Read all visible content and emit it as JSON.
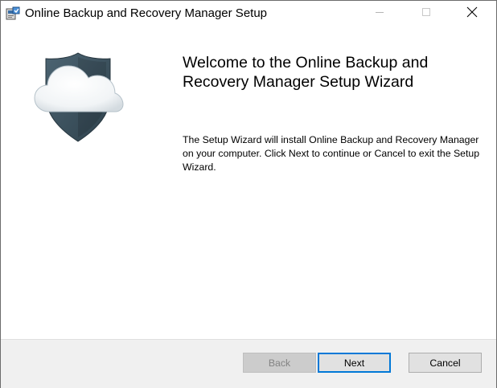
{
  "window": {
    "title": "Online Backup and Recovery Manager Setup"
  },
  "content": {
    "heading": "Welcome to the Online Backup and Recovery Manager Setup Wizard",
    "description": "The Setup Wizard will install Online Backup and Recovery Manager on your computer. Click Next to continue or Cancel to exit the Setup Wizard."
  },
  "buttons": {
    "back": "Back",
    "next": "Next",
    "cancel": "Cancel"
  },
  "icons": {
    "app": "installer-icon",
    "logo": "cloud-shield-logo",
    "minimize": "minimize-icon",
    "maximize": "maximize-icon",
    "close": "close-icon"
  },
  "colors": {
    "accent": "#0078d7",
    "shield": "#3e5360",
    "footer_bg": "#f0f0f0"
  },
  "state": {
    "back_enabled": false,
    "focused_button": "next"
  }
}
